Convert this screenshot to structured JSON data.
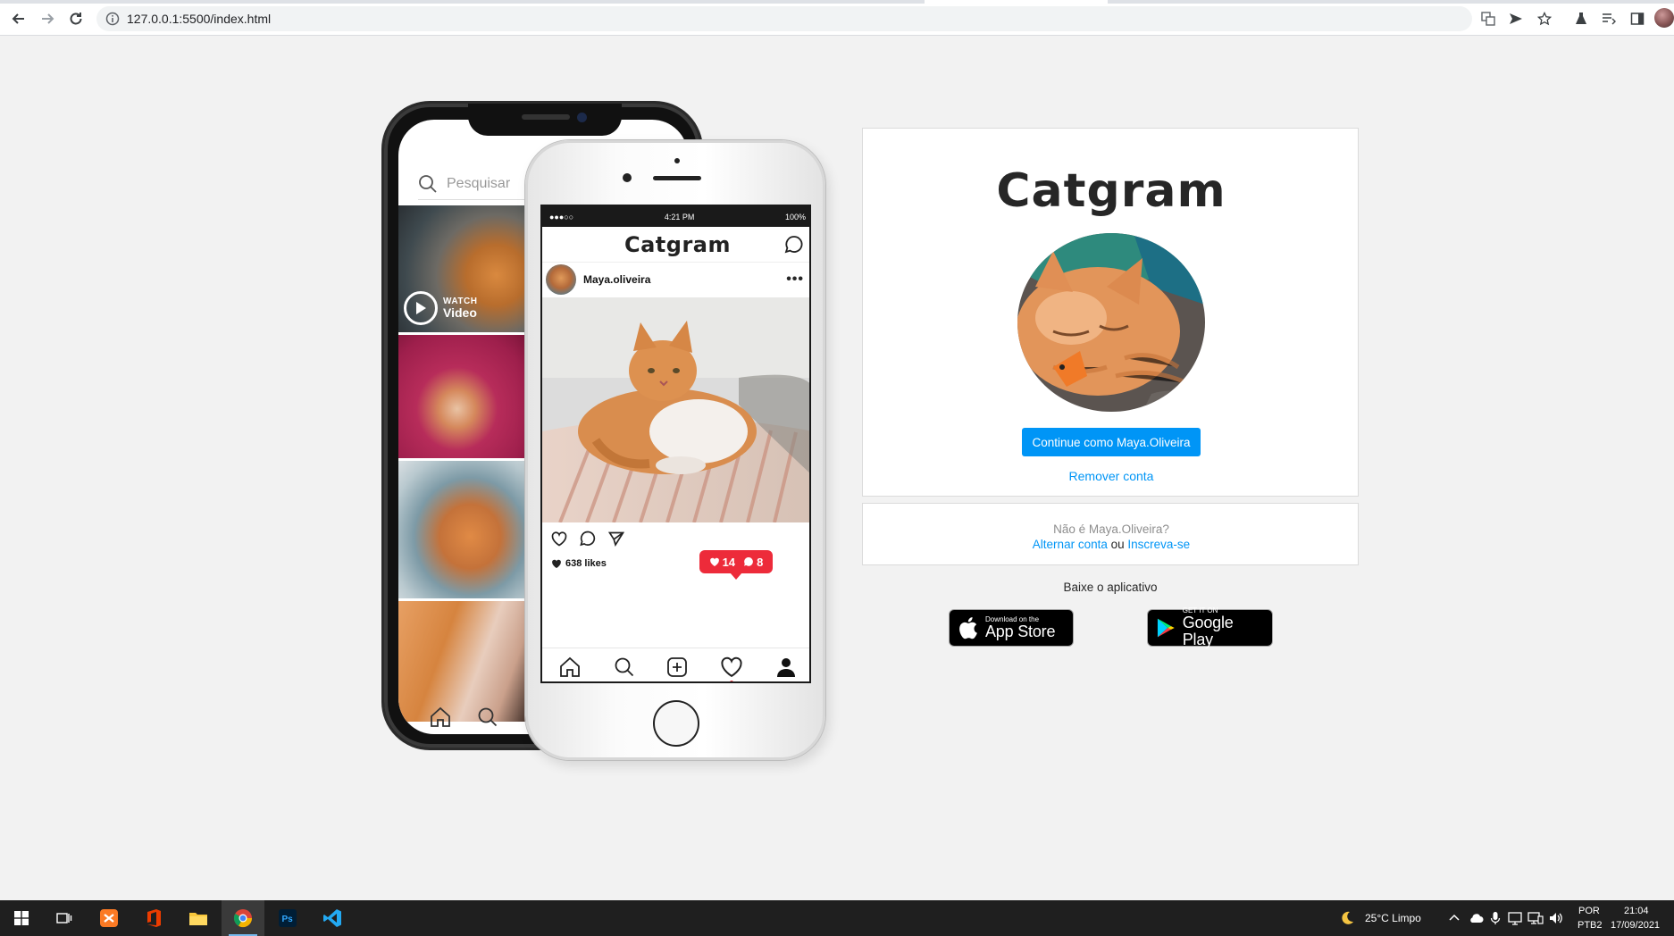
{
  "browser": {
    "url": "127.0.0.1:5500/index.html"
  },
  "back_phone": {
    "search_placeholder": "Pesquisar",
    "watch_small": "WATCH",
    "watch_big": "Video"
  },
  "front_phone": {
    "status_time": "4:21 PM",
    "status_battery": "100%",
    "status_signal": "●●●○○",
    "app_name": "Catgram",
    "username": "Maya.oliveira",
    "more": "•••",
    "likes": "638 likes",
    "notif_likes": "14",
    "notif_comments": "8"
  },
  "login": {
    "logo": "Catgram",
    "continue_label": "Continue como Maya.Oliveira",
    "remove_label": "Remover conta",
    "not_you": "Não é Maya.Oliveira?",
    "switch_label": "Alternar conta",
    "or": "ou",
    "signup_label": "Inscreva-se",
    "get_app": "Baixe o aplicativo",
    "appstore_small": "Download on the",
    "appstore_big": "App Store",
    "googleplay_small": "GET IT ON",
    "googleplay_big": "Google Play"
  },
  "taskbar": {
    "weather": "25°C  Limpo",
    "lang1": "POR",
    "lang2": "PTB2",
    "time": "21:04",
    "date": "17/09/2021"
  },
  "colors": {
    "accent": "#0095f6",
    "notification": "#ed2b3a",
    "page_bg": "#f2f2f2"
  }
}
